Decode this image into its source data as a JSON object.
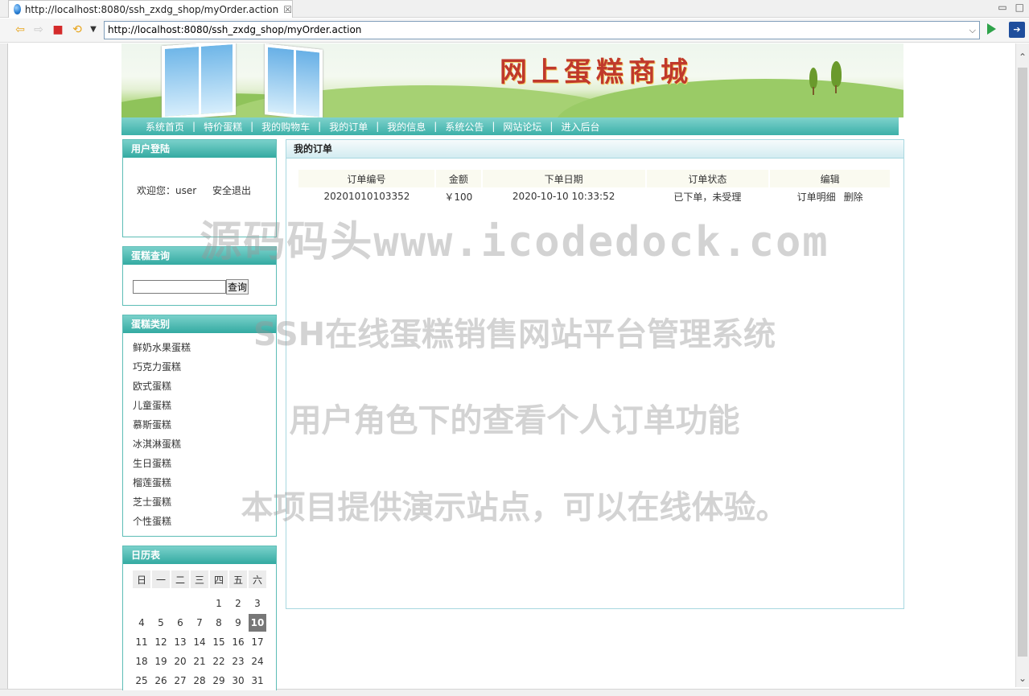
{
  "browser": {
    "tab_title": "http://localhost:8080/ssh_zxdg_shop/myOrder.action",
    "tab_close": "☒",
    "url": "http://localhost:8080/ssh_zxdg_shop/myOrder.action"
  },
  "site": {
    "title": "网上蛋糕商城",
    "menu": [
      "系统首页",
      "特价蛋糕",
      "我的购物车",
      "我的订单",
      "我的信息",
      "系统公告",
      "网站论坛",
      "进入后台"
    ]
  },
  "login_box": {
    "title": "用户登陆",
    "welcome": "欢迎您：user",
    "logout": "安全退出"
  },
  "search_box": {
    "title": "蛋糕查询",
    "button": "查询",
    "value": ""
  },
  "category_box": {
    "title": "蛋糕类别",
    "items": [
      "鲜奶水果蛋糕",
      "巧克力蛋糕",
      "欧式蛋糕",
      "儿童蛋糕",
      "慕斯蛋糕",
      "冰淇淋蛋糕",
      "生日蛋糕",
      "榴莲蛋糕",
      "芝士蛋糕",
      "个性蛋糕"
    ]
  },
  "calendar": {
    "title": "日历表",
    "weekdays": [
      "日",
      "一",
      "二",
      "三",
      "四",
      "五",
      "六"
    ],
    "weeks": [
      [
        "",
        "",
        "",
        "",
        "1",
        "2",
        "3"
      ],
      [
        "4",
        "5",
        "6",
        "7",
        "8",
        "9",
        "10"
      ],
      [
        "11",
        "12",
        "13",
        "14",
        "15",
        "16",
        "17"
      ],
      [
        "18",
        "19",
        "20",
        "21",
        "22",
        "23",
        "24"
      ],
      [
        "25",
        "26",
        "27",
        "28",
        "29",
        "30",
        "31"
      ]
    ],
    "today": "10"
  },
  "orders": {
    "title": "我的订单",
    "columns": [
      "订单编号",
      "金额",
      "下单日期",
      "订单状态",
      "编辑"
    ],
    "rows": [
      {
        "order_no": "20201010103352",
        "amount": "￥100",
        "date": "2020-10-10 10:33:52",
        "status": "已下单，未受理",
        "detail": "订单明细",
        "delete": "删除"
      }
    ]
  },
  "watermark": {
    "line1": "源码码头www.icodedock.com",
    "line2": "SSH在线蛋糕销售网站平台管理系统",
    "line3": "用户角色下的查看个人订单功能",
    "line4": "本项目提供演示站点，可以在线体验。"
  }
}
